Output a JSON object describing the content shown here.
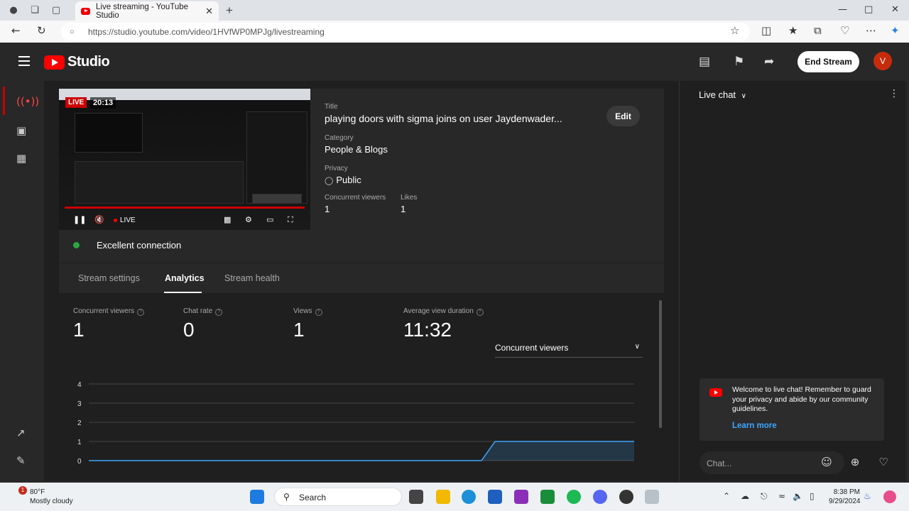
{
  "browser": {
    "tab_title": "Live streaming - YouTube Studio",
    "url": "https://studio.youtube.com/video/1HVfWP0MPJg/livestreaming"
  },
  "studio": {
    "logo_text": "Studio",
    "end_stream_label": "End Stream",
    "avatar_initial": "V"
  },
  "preview": {
    "live_badge": "LIVE",
    "elapsed": "20:13",
    "player_live": "LIVE"
  },
  "details": {
    "title_label": "Title",
    "title_value": "playing doors with sigma joins on user Jaydenwader...",
    "category_label": "Category",
    "category_value": "People & Blogs",
    "privacy_label": "Privacy",
    "privacy_value": "Public",
    "concurrent_label": "Concurrent viewers",
    "concurrent_value": "1",
    "likes_label": "Likes",
    "likes_value": "1",
    "edit_label": "Edit"
  },
  "connection": {
    "status": "Excellent connection"
  },
  "tabs": [
    {
      "label": "Stream settings"
    },
    {
      "label": "Analytics"
    },
    {
      "label": "Stream health"
    }
  ],
  "metrics": [
    {
      "label": "Concurrent viewers",
      "value": "1"
    },
    {
      "label": "Chat rate",
      "value": "0"
    },
    {
      "label": "Views",
      "value": "1"
    },
    {
      "label": "Average view duration",
      "value": "11:32"
    }
  ],
  "chart_selector": "Concurrent viewers",
  "chart_data": {
    "type": "area",
    "y_ticks": [
      "4",
      "3",
      "2",
      "1",
      "0"
    ],
    "ylim": [
      0,
      4
    ],
    "grid": true,
    "x": [
      0,
      0.72,
      0.745,
      1
    ],
    "values": [
      0,
      0,
      1,
      1
    ],
    "color": "#3ea6ff"
  },
  "chat": {
    "header": "Live chat",
    "welcome_text": "Welcome to live chat! Remember to guard your privacy and abide by our community guidelines.",
    "learn_more": "Learn more",
    "input_placeholder": "Chat..."
  },
  "taskbar": {
    "temperature": "80°F",
    "weather": "Mostly cloudy",
    "notification_count": "1",
    "search_label": "Search",
    "time": "8:38 PM",
    "date": "9/29/2024"
  }
}
